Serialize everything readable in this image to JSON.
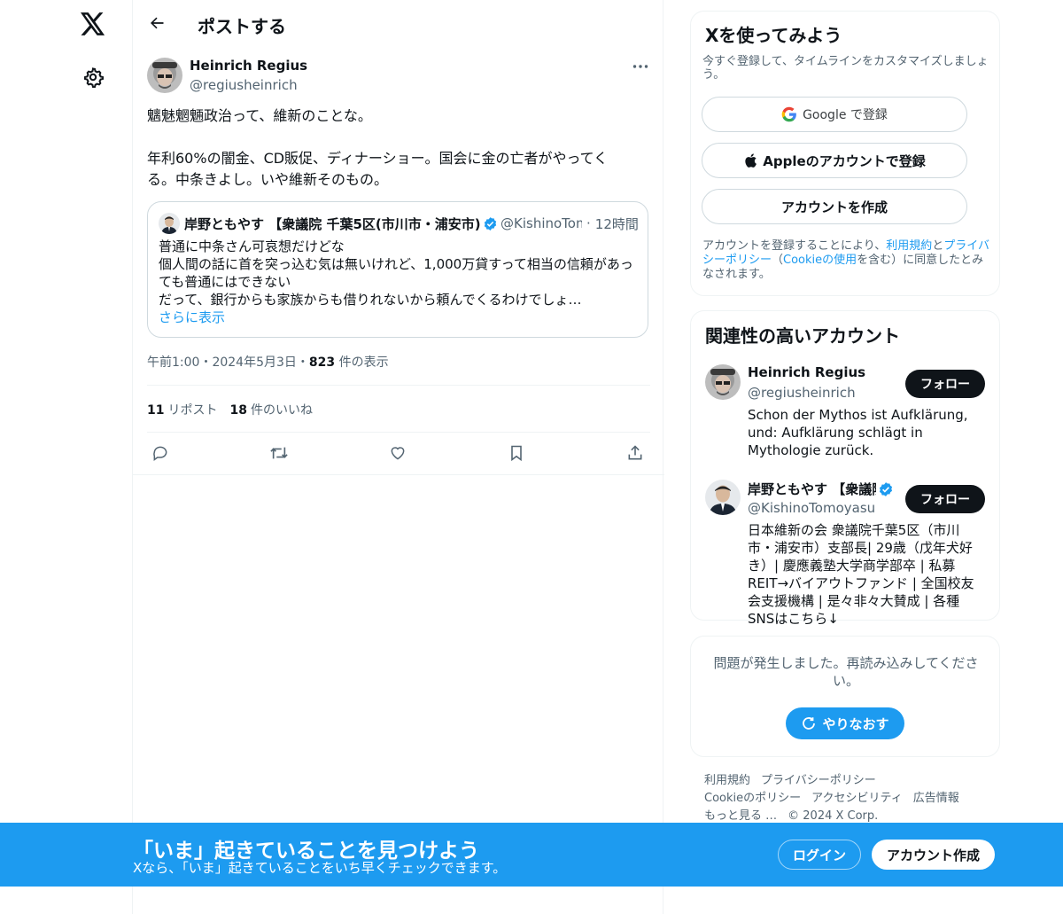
{
  "header": {
    "title": "ポストする",
    "back_icon": "arrow-left-icon"
  },
  "post": {
    "author_name": "Heinrich Regius",
    "author_handle": "@regiusheinrich",
    "lines": [
      "魑魅魍魎政治って、維新のことな。",
      "年利60%の闇金、CD販促、ディナーショー。国会に金の亡者がやってく",
      "る。中条きよし。いや維新そのもの。"
    ],
    "timestamp": "午前1:00・2024年5月3日・",
    "views_count": "823",
    "views_label": " 件の表示",
    "reposts_count": "11",
    "reposts_label": "リポスト",
    "likes_count": "18",
    "likes_label": "件のいいね"
  },
  "quote": {
    "author_name": "岸野ともやす 【衆議院 千葉5区(市川市・浦安市)】",
    "author_handle": "@KishinoTomoyasu",
    "time": "12時間",
    "lines": [
      "普通に中条さん可哀想だけどな",
      "個人間の話に首を突っ込む気は無いけれど、1,000万貸すって相当の信頼があっ",
      "ても普通にはできない",
      "だって、銀行からも家族からも借りれないから頼んでくるわけでしょ…"
    ],
    "show_more": "さらに表示"
  },
  "signup_card": {
    "title": "Xを使ってみよう",
    "subtitle": "今すぐ登録して、タイムラインをカスタマイズしましょう。",
    "google_label": "Google で登録",
    "apple_label": "Appleのアカウントで登録",
    "create_label": "アカウントを作成",
    "legal_prefix": "アカウントを登録することにより、",
    "legal_terms": "利用規約",
    "legal_and": "と",
    "legal_privacy": "プライバシーポリシー",
    "legal_paren_open": "（",
    "legal_cookie": "Cookieの使用",
    "legal_suffix": "を含む）に同意したとみなされます。"
  },
  "related": {
    "title": "関連性の高いアカウント",
    "follow_label": "フォロー",
    "accounts": [
      {
        "name": "Heinrich Regius",
        "handle": "@regiusheinrich",
        "bio": "Schon der Mythos ist Aufklärung, und: Aufklärung schlägt in Mythologie zurück."
      },
      {
        "name": "岸野ともやす 【衆議院",
        "handle": "@KishinoTomoyasu",
        "bio": "日本維新の会 衆議院千葉5区（市川市・浦安市）支部長| 29歳（戊年犬好き）| 慶應義塾大学商学部卒 | 私募REIT→バイアウトファンド | 全国校友会支援機構 | 是々非々大賛成 | 各種SNSはこちら↓"
      }
    ]
  },
  "error_card": {
    "message": "問題が発生しました。再読み込みしてください。",
    "retry_label": "やりなおす"
  },
  "footer": {
    "terms": "利用規約",
    "privacy": "プライバシーポリシー",
    "cookie": "Cookieのポリシー",
    "accessibility": "アクセシビリティ",
    "ads": "広告情報",
    "more": "もっと見る …",
    "copyright": "© 2024 X Corp."
  },
  "banner": {
    "title": "「いま」起きていることを見つけよう",
    "subtitle": "Xなら、「いま」起きていることをいち早くチェックできます。",
    "login_label": "ログイン",
    "signup_label": "アカウント作成"
  },
  "colors": {
    "accent": "#1d9bf0",
    "text": "#0f1419",
    "muted": "#536471",
    "border": "#eff3f4"
  }
}
